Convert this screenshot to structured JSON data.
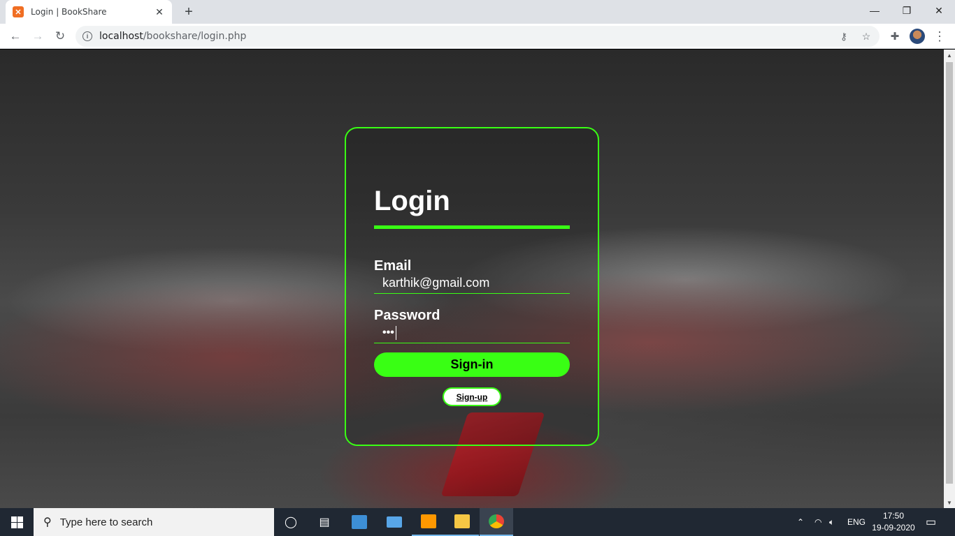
{
  "browser": {
    "tab": {
      "title": "Login | BookShare",
      "favicon": "xampp-icon"
    },
    "new_tab": "+",
    "window_controls": {
      "minimize": "—",
      "restore": "❐",
      "close": "✕"
    },
    "url": {
      "host": "localhost",
      "path": "/bookshare/login.php"
    },
    "nav": {
      "back": "←",
      "forward": "→",
      "reload": "↻"
    }
  },
  "login": {
    "title": "Login",
    "email_label": "Email",
    "email_value": "karthik@gmail.com",
    "password_label": "Password",
    "password_value": "•••",
    "signin_label": "Sign-in",
    "signup_label": "Sign-up"
  },
  "colors": {
    "accent": "#39ff14"
  },
  "taskbar": {
    "search_placeholder": "Type here to search",
    "language": "ENG",
    "time": "17:50",
    "date": "19-09-2020"
  }
}
